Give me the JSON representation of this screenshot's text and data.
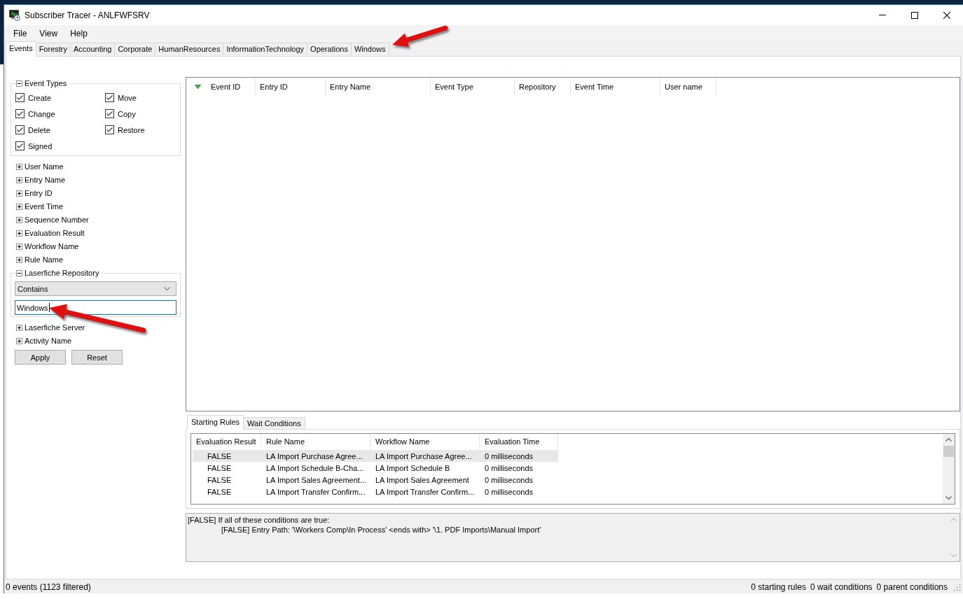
{
  "window": {
    "title": "Subscriber Tracer - ANLFWFSRV"
  },
  "menu": [
    "File",
    "View",
    "Help"
  ],
  "tabs": [
    {
      "label": "Events",
      "selected": true
    },
    {
      "label": "Forestry",
      "selected": false
    },
    {
      "label": "Accounting",
      "selected": false
    },
    {
      "label": "Corporate",
      "selected": false
    },
    {
      "label": "HumanResources",
      "selected": false
    },
    {
      "label": "InformationTechnology",
      "selected": false
    },
    {
      "label": "Operations",
      "selected": false
    },
    {
      "label": "Windows",
      "selected": false
    }
  ],
  "filter_panel": {
    "event_types": {
      "label": "Event Types",
      "expanded": true,
      "options": [
        {
          "label": "Create",
          "checked": true
        },
        {
          "label": "Move",
          "checked": true
        },
        {
          "label": "Change",
          "checked": true
        },
        {
          "label": "Copy",
          "checked": true
        },
        {
          "label": "Delete",
          "checked": true
        },
        {
          "label": "Restore",
          "checked": true
        },
        {
          "label": "Signed",
          "checked": true
        }
      ]
    },
    "filters": [
      {
        "label": "User Name",
        "expanded": false
      },
      {
        "label": "Entry Name",
        "expanded": false
      },
      {
        "label": "Entry ID",
        "expanded": false
      },
      {
        "label": "Event Time",
        "expanded": false
      },
      {
        "label": "Sequence Number",
        "expanded": false
      },
      {
        "label": "Evaluation Result",
        "expanded": false
      },
      {
        "label": "Workflow Name",
        "expanded": false
      },
      {
        "label": "Rule Name",
        "expanded": false
      },
      {
        "label": "Laserfiche Repository",
        "expanded": true,
        "criteria": {
          "condition": "Contains",
          "value": "Windows"
        }
      },
      {
        "label": "Laserfiche Server",
        "expanded": false
      },
      {
        "label": "Activity Name",
        "expanded": false
      }
    ],
    "buttons": [
      "Apply",
      "Reset"
    ]
  },
  "events_table": {
    "columns": [
      {
        "label": "Event ID",
        "sorted": true
      },
      {
        "label": "Entry ID",
        "sorted": false
      },
      {
        "label": "Entry Name",
        "sorted": false
      },
      {
        "label": "Event Type",
        "sorted": false
      },
      {
        "label": "Repository",
        "sorted": false
      },
      {
        "label": "Event Time",
        "sorted": false
      },
      {
        "label": "User name",
        "sorted": false
      }
    ]
  },
  "detail_tabs": [
    {
      "label": "Starting Rules",
      "selected": true
    },
    {
      "label": "Wait Conditions",
      "selected": false
    }
  ],
  "rules_table": {
    "columns": [
      "Evaluation Result",
      "Rule Name",
      "Workflow Name",
      "Evaluation Time"
    ],
    "rows": [
      {
        "cells": [
          "FALSE",
          "LA Import Purchase Agree...",
          "LA Import Purchase Agree...",
          "0 milliseconds"
        ],
        "selected": true
      },
      {
        "cells": [
          "FALSE",
          "LA Import Schedule B-Cha...",
          "LA Import Schedule B",
          "0 milliseconds"
        ],
        "selected": false
      },
      {
        "cells": [
          "FALSE",
          "LA Import Sales Agreement...",
          "LA Import Sales Agreement",
          "0 milliseconds"
        ],
        "selected": false
      },
      {
        "cells": [
          "FALSE",
          "LA Import Transfer Confirm...",
          "LA Import Transfer Confirm...",
          "0 milliseconds"
        ],
        "selected": false
      }
    ]
  },
  "condition_details": [
    {
      "text": "[FALSE] If all of these conditions are true:",
      "children": [
        {
          "text": "[FALSE] Entry Path: '\\Workers Comp\\In Process' <ends with> '\\1. PDF Imports\\Manual Import'"
        }
      ]
    }
  ],
  "status_bar": {
    "summary": "0 events (1123 filtered)",
    "counts": [
      "0 starting rules",
      "0 wait conditions",
      "0 parent conditions"
    ]
  }
}
